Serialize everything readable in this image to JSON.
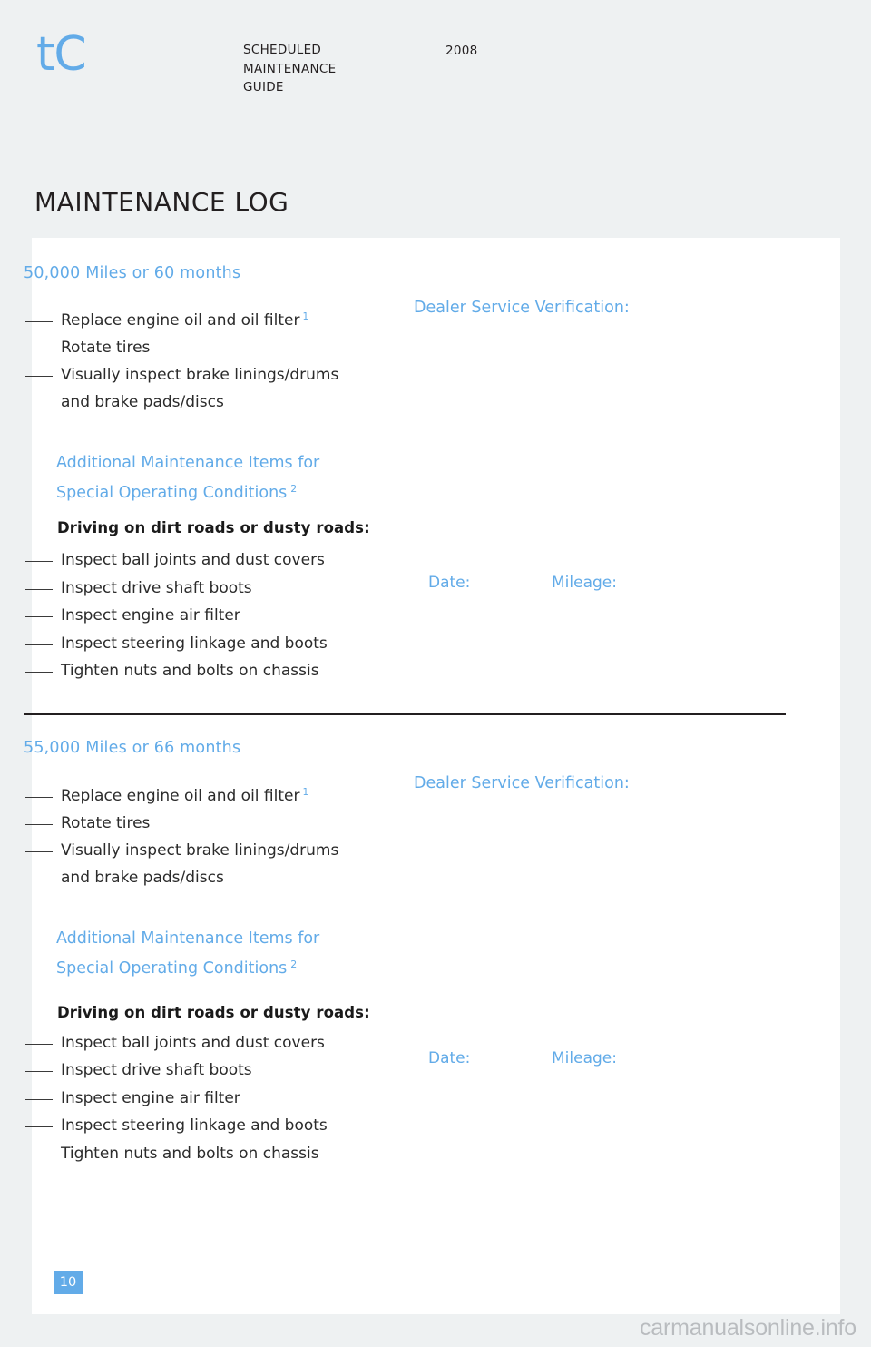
{
  "header": {
    "brand_logo": "tC",
    "guide_title": "SCHEDULED\nMAINTENANCE\nGUIDE",
    "year": "2008"
  },
  "page_title": "MAINTENANCE LOG",
  "sections": [
    {
      "heading": "50,000 Miles or 60 months",
      "primary_items": [
        "Replace engine oil and oil filter",
        "Rotate tires",
        "Visually inspect brake linings/drums",
        "and brake pads/discs"
      ],
      "primary_footnote": "1",
      "additional_heading_line1": "Additional Maintenance Items for",
      "additional_heading_line2": "Special Operating Conditions",
      "additional_footnote": "2",
      "driving_heading": "Driving on dirt roads or dusty roads:",
      "additional_items": [
        "Inspect ball joints and dust covers",
        "Inspect drive shaft boots",
        "Inspect engine air filter",
        "Inspect steering linkage and boots",
        "Tighten nuts and bolts on chassis"
      ],
      "dealer_verification": "Dealer Service Verification:",
      "date_label": "Date:",
      "mileage_label": "Mileage:"
    },
    {
      "heading": "55,000 Miles or 66 months",
      "primary_items": [
        "Replace engine oil and oil filter",
        "Rotate tires",
        "Visually inspect brake linings/drums",
        "and brake pads/discs"
      ],
      "primary_footnote": "1",
      "additional_heading_line1": "Additional Maintenance Items for",
      "additional_heading_line2": "Special Operating Conditions",
      "additional_footnote": "2",
      "driving_heading": "Driving on dirt roads or dusty roads:",
      "additional_items": [
        "Inspect ball joints and dust covers",
        "Inspect drive shaft boots",
        "Inspect engine air filter",
        "Inspect steering linkage and boots",
        "Tighten nuts and bolts on chassis"
      ],
      "dealer_verification": "Dealer Service Verification:",
      "date_label": "Date:",
      "mileage_label": "Mileage:"
    }
  ],
  "page_number": "10",
  "watermark": "carmanualsonline.info",
  "colors": {
    "accent_blue": "#62abe8",
    "page_background": "#eef1f2",
    "card_background": "#ffffff",
    "body_text": "#2b2b2b",
    "rule": "#231f20"
  }
}
